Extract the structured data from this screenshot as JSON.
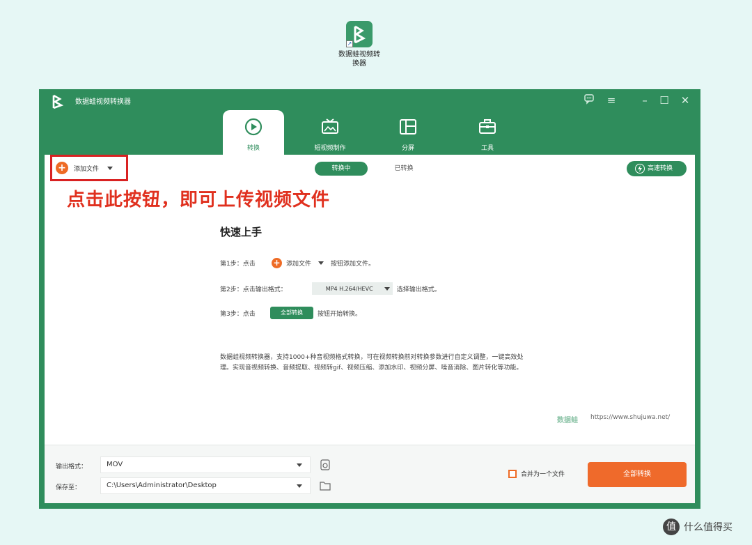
{
  "desktop": {
    "icon_label": "数据蛙视频转\n换器",
    "icon_name": "app-logo-icon"
  },
  "window": {
    "title": "数据蛙视频转换器",
    "controls": [
      "feedback-icon",
      "menu-icon",
      "minimize-icon",
      "maximize-icon",
      "close-icon"
    ],
    "accent": "#2f8d5c"
  },
  "tabs": [
    {
      "label": "转换",
      "icon": "convert-icon",
      "active": true
    },
    {
      "label": "短视频制作",
      "icon": "tv-icon",
      "active": false
    },
    {
      "label": "分屏",
      "icon": "split-screen-icon",
      "active": false
    },
    {
      "label": "工具",
      "icon": "toolbox-icon",
      "active": false
    }
  ],
  "toolbar": {
    "add_file": "添加文件",
    "seg_converting": "转换中",
    "seg_converted": "已转换",
    "fast_convert": "高速转换"
  },
  "annotation": "点击此按钮，即可上传视频文件",
  "quickstart": {
    "title": "快速上手",
    "step1": {
      "label": "第1步：点击",
      "button": "添加文件",
      "after": "按钮添加文件。"
    },
    "step2": {
      "label": "第2步：点击输出格式：",
      "format": "MP4 H.264/HEVC",
      "after": "选择输出格式。"
    },
    "step3": {
      "label": "第3步：点击",
      "button": "全部转换",
      "after": "按钮开始转换。"
    },
    "description": "数据蛙视频转换器，支持1000+种音视频格式转换，可在视频转换前对转换参数进行自定义调整，一键高效处理。实现音视频转换、音频提取、视频转gif、视频压缩、添加水印、视频分屏、噪音消除、图片转化等功能。",
    "brand": "数据蛙",
    "url": "https://www.shujuwa.net/"
  },
  "bottom": {
    "format_label": "输出格式：",
    "format_value": "MOV",
    "save_label": "保存至：",
    "save_value": "C:\\Users\\Administrator\\Desktop",
    "merge_label": "合并为一个文件",
    "convert_all": "全部转换"
  },
  "watermark": {
    "text": "什么值得买",
    "logo": "值"
  }
}
